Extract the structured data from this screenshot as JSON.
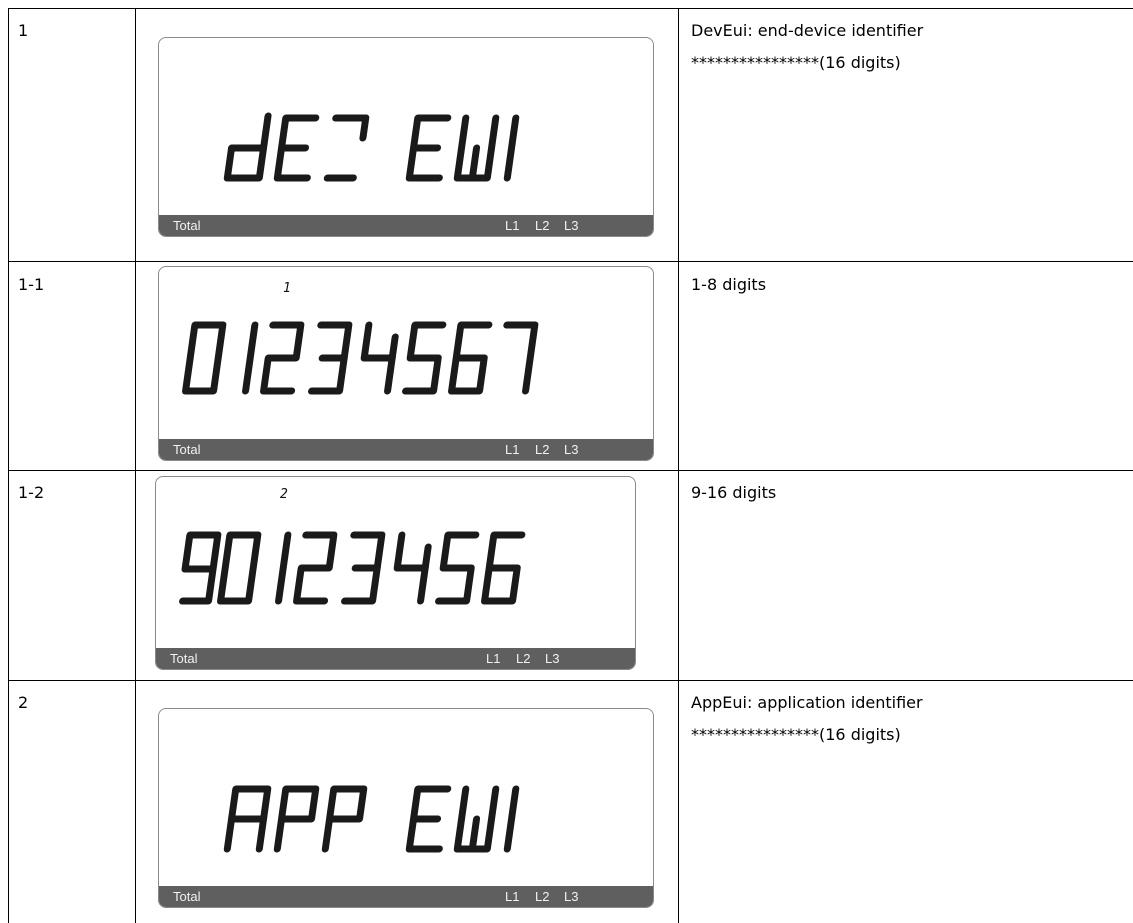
{
  "rows": [
    {
      "index": "1",
      "display": "dEV EUI",
      "subscript": "",
      "phases": [
        "L1",
        "L2",
        "L3"
      ],
      "total_label": "Total",
      "description": [
        "DevEui: end-device identifier",
        "****************(16 digits)"
      ]
    },
    {
      "index": "1-1",
      "display": "01234567",
      "subscript": "1",
      "phases": [
        "L1",
        "L2",
        "L3"
      ],
      "total_label": "Total",
      "description": [
        "1-8 digits"
      ]
    },
    {
      "index": "1-2",
      "display": "90123456",
      "subscript": "2",
      "phases": [
        "L1",
        "L2",
        "L3"
      ],
      "total_label": "Total",
      "description": [
        "9-16 digits"
      ]
    },
    {
      "index": "2",
      "display": "APP EUI",
      "subscript": "",
      "phases": [
        "L1",
        "L2",
        "L3"
      ],
      "total_label": "Total",
      "description": [
        "AppEui: application identifier",
        "****************(16 digits)"
      ]
    }
  ]
}
